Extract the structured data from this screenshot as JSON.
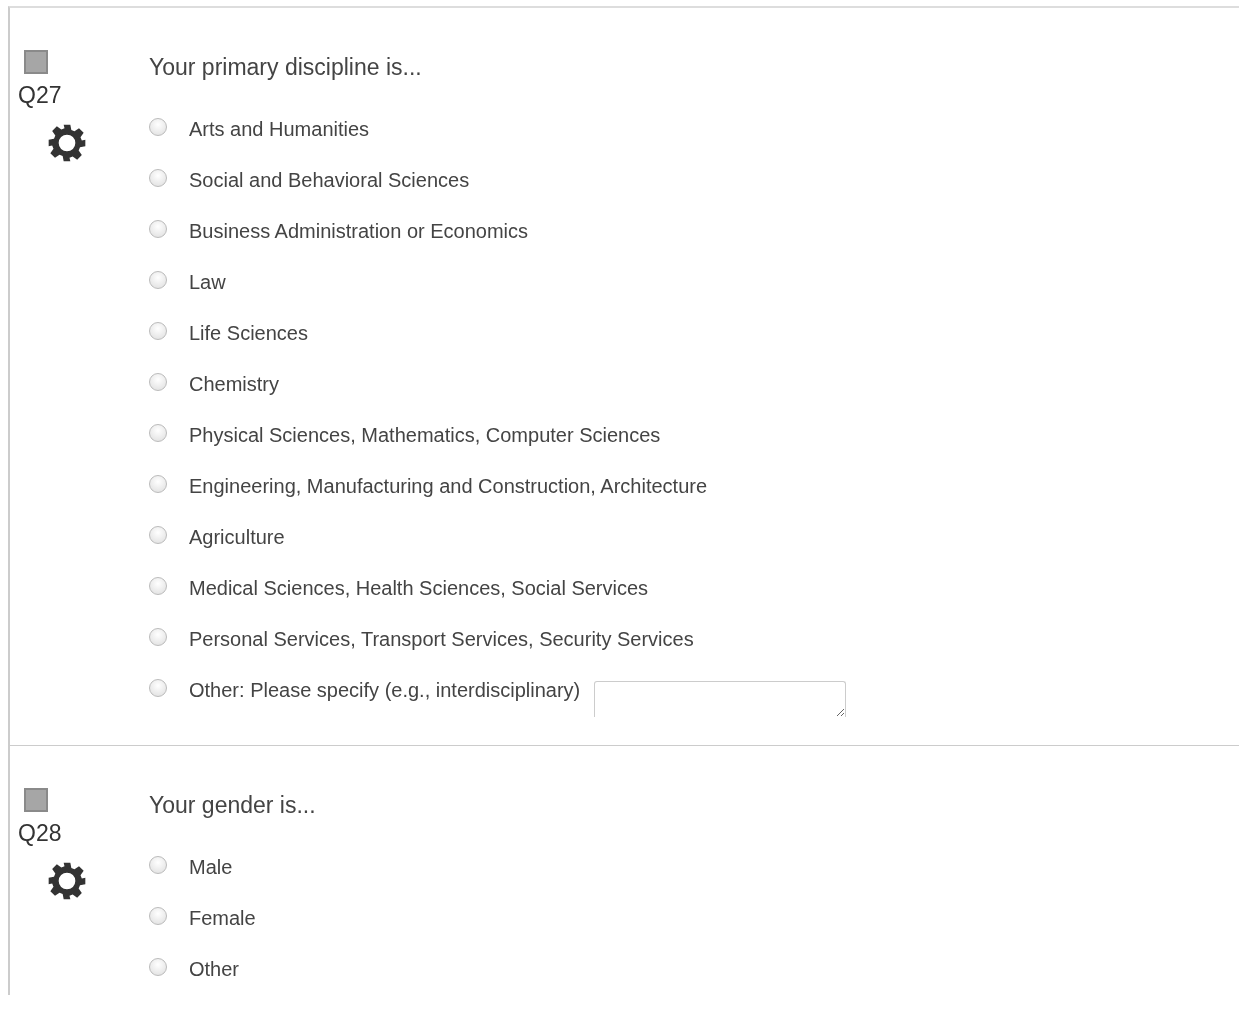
{
  "questions": [
    {
      "number": "Q27",
      "checked": false,
      "text": "Your primary discipline is...",
      "options": [
        {
          "label": "Arts and Humanities",
          "selected": false,
          "kind": "plain"
        },
        {
          "label": "Social and Behavioral Sciences",
          "selected": false,
          "kind": "plain"
        },
        {
          "label": "Business Administration or Economics",
          "selected": false,
          "kind": "plain"
        },
        {
          "label": "Law",
          "selected": false,
          "kind": "plain"
        },
        {
          "label": "Life Sciences",
          "selected": false,
          "kind": "plain"
        },
        {
          "label": "Chemistry",
          "selected": false,
          "kind": "plain"
        },
        {
          "label": "Physical Sciences, Mathematics, Computer Sciences",
          "selected": false,
          "kind": "plain"
        },
        {
          "label": "Engineering, Manufacturing and Construction, Architecture",
          "selected": false,
          "kind": "plain"
        },
        {
          "label": "Agriculture",
          "selected": false,
          "kind": "plain"
        },
        {
          "label": "Medical Sciences, Health Sciences, Social Services",
          "selected": false,
          "kind": "plain"
        },
        {
          "label": "Personal Services, Transport Services, Security Services",
          "selected": false,
          "kind": "plain"
        },
        {
          "label": "Other: Please specify (e.g., interdisciplinary)",
          "selected": false,
          "kind": "text-entry"
        }
      ]
    },
    {
      "number": "Q28",
      "checked": false,
      "text": "Your gender is...",
      "options": [
        {
          "label": "Male",
          "selected": false,
          "kind": "plain"
        },
        {
          "label": "Female",
          "selected": false,
          "kind": "plain"
        },
        {
          "label": "Other",
          "selected": false,
          "kind": "plain"
        }
      ]
    }
  ]
}
